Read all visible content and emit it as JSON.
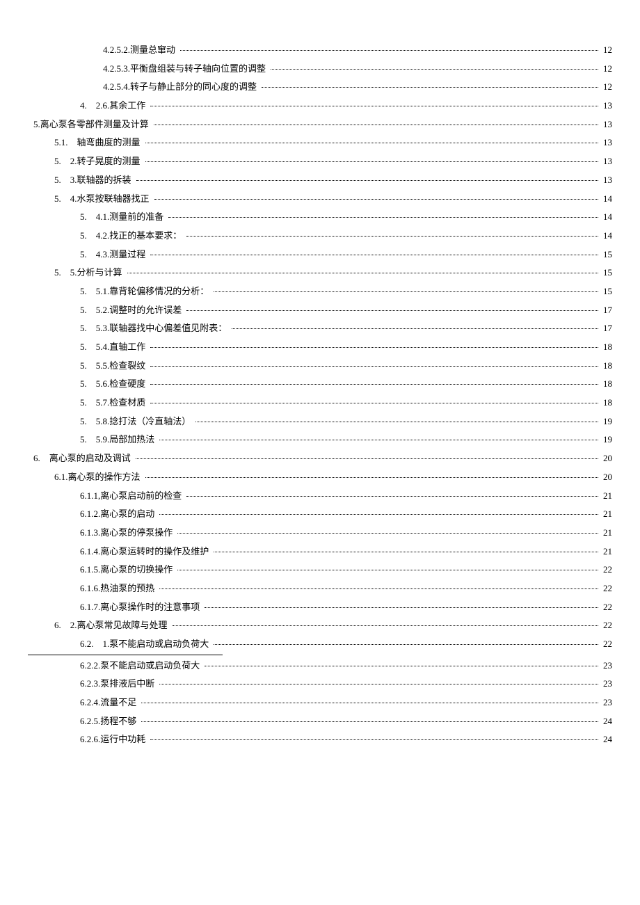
{
  "toc": [
    {
      "indent": 3,
      "label": "4.2.5.2.测量总窜动",
      "page": "12"
    },
    {
      "indent": 3,
      "label": "4.2.5.3.平衡盘组装与转子轴向位置的调整",
      "page": "12"
    },
    {
      "indent": 3,
      "label": "4.2.5.4.转子与静止部分的同心度的调整",
      "page": "12"
    },
    {
      "indent": 2,
      "label": "4.　2.6.其余工作",
      "page": "13"
    },
    {
      "indent": 0,
      "label": "5.离心泵各零部件测量及计算",
      "page": "13"
    },
    {
      "indent": 1,
      "label": "5.1.　轴弯曲度的测量",
      "page": "13"
    },
    {
      "indent": 1,
      "label": "5.　2.转子晃度的测量",
      "page": "13"
    },
    {
      "indent": 1,
      "label": "5.　3.联轴器的拆装",
      "page": "13"
    },
    {
      "indent": 1,
      "label": "5.　4.水泵按联轴器找正",
      "page": "14"
    },
    {
      "indent": 2,
      "label": "5.　4.1.测量前的准备",
      "page": "14"
    },
    {
      "indent": 2,
      "label": "5.　4.2.找正的基本要求：",
      "page": "14"
    },
    {
      "indent": 2,
      "label": "5.　4.3.测量过程",
      "page": "15"
    },
    {
      "indent": 1,
      "label": "5.　5.分析与计算",
      "page": "15"
    },
    {
      "indent": 2,
      "label": "5.　5.1.靠背轮偏移情况的分析：",
      "page": "15"
    },
    {
      "indent": 2,
      "label": "5.　5.2.调整时的允许误差",
      "page": "17"
    },
    {
      "indent": 2,
      "label": "5.　5.3.联轴器找中心偏差值见附表：",
      "page": "17"
    },
    {
      "indent": 2,
      "label": "5.　5.4.直轴工作",
      "page": "18"
    },
    {
      "indent": 2,
      "label": "5.　5.5.检查裂纹",
      "page": "18"
    },
    {
      "indent": 2,
      "label": "5.　5.6.检查硬度",
      "page": "18"
    },
    {
      "indent": 2,
      "label": "5.　5.7.检查材质",
      "page": "18"
    },
    {
      "indent": 2,
      "label": "5.　5.8.捻打法（冷直轴法）",
      "page": "19"
    },
    {
      "indent": 2,
      "label": "5.　5.9.局部加热法",
      "page": "19"
    },
    {
      "indent": 0,
      "label": "6.　离心泵的启动及调试",
      "page": "20"
    },
    {
      "indent": 1,
      "label": "6.1.离心泵的操作方法",
      "page": "20"
    },
    {
      "indent": 2,
      "label": "6.1.1,离心泵启动前的检查",
      "page": "21"
    },
    {
      "indent": 2,
      "label": "6.1.2.离心泵的启动",
      "page": "21"
    },
    {
      "indent": 2,
      "label": "6.1.3.离心泵的停泵操作",
      "page": "21"
    },
    {
      "indent": 2,
      "label": "6.1.4.离心泵运转时的操作及维护",
      "page": "21"
    },
    {
      "indent": 2,
      "label": "6.1.5.离心泵的切换操作",
      "page": "22"
    },
    {
      "indent": 2,
      "label": "6.1.6.热油泵的预热",
      "page": "22"
    },
    {
      "indent": 2,
      "label": "6.1.7.离心泵操作时的注意事项",
      "page": "22"
    },
    {
      "indent": 1,
      "label": "6.　2.离心泵常见故障与处理",
      "page": "22"
    },
    {
      "indent": 2,
      "label": "6.2.　1.泵不能启动或启动负荷大",
      "page": "22",
      "sep_after": true
    },
    {
      "indent": 2,
      "label": "6.2.2.泵不能启动或启动负荷大",
      "page": "23"
    },
    {
      "indent": 2,
      "label": "6.2.3.泵排液后中断",
      "page": "23"
    },
    {
      "indent": 2,
      "label": "6.2.4.流量不足",
      "page": "23"
    },
    {
      "indent": 2,
      "label": "6.2.5.扬程不够",
      "page": "24"
    },
    {
      "indent": 2,
      "label": "6.2.6.运行中功耗",
      "page": "24"
    }
  ]
}
